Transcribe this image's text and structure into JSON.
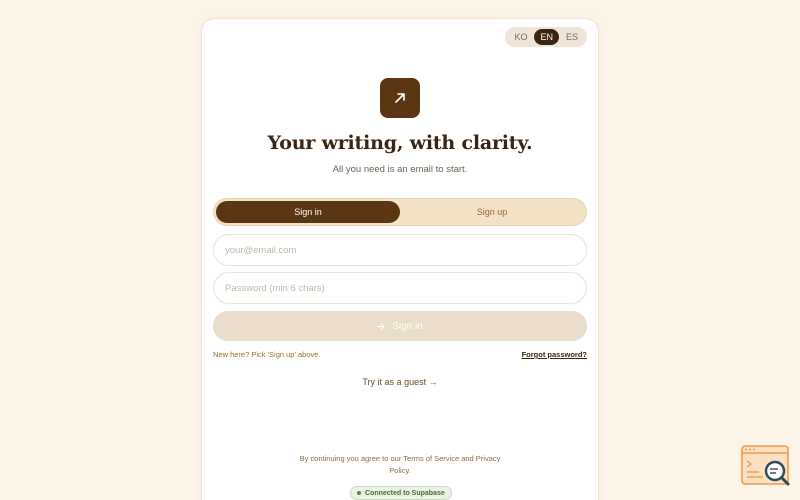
{
  "language_switch": {
    "options": [
      "KO",
      "EN",
      "ES"
    ],
    "selected": "EN"
  },
  "header": {
    "title": "Your writing, with clarity.",
    "subtitle": "All you need is an email to start."
  },
  "auth_tabs": {
    "sign_in": "Sign in",
    "sign_up": "Sign up",
    "active": "Sign in"
  },
  "form": {
    "email_placeholder": "your@email.com",
    "password_placeholder": "Password (min 6 chars)",
    "submit_label": "Sign in"
  },
  "hint_text": "New here? Pick 'Sign up' above.",
  "forgot_password": "Forgot password?",
  "guest_link": "Try it as a guest →",
  "legal": "By continuing you agree to our Terms of Service and Privacy Policy.",
  "status_badge": "Connected to Supabase",
  "colors": {
    "page_background": "#fdf4e8",
    "brand_dark": "#5a3612",
    "accent": "#a36a30",
    "status_green": "#5c8a3e"
  },
  "icons": {
    "logo": "arrow-up-right-icon",
    "submit": "arrow-right-icon",
    "corner_widget": "search-icon"
  }
}
